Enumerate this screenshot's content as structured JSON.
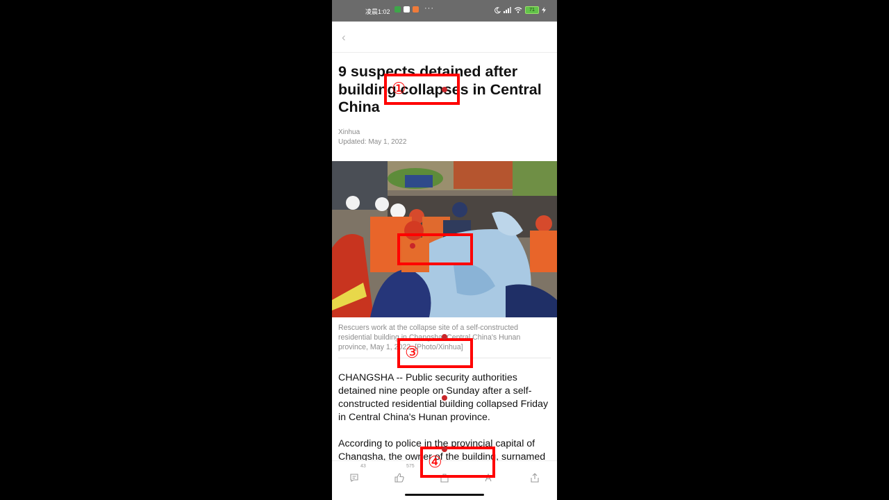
{
  "status_bar": {
    "time": "凌晨1:02",
    "dots": "···",
    "battery": "71",
    "icons": [
      "moon-icon",
      "signal-icon",
      "wifi-icon",
      "battery-icon",
      "charging-icon"
    ],
    "app_icon_colors": [
      "#3ea64a",
      "#e94c3c",
      "#f07b3a"
    ]
  },
  "header": {
    "back_icon": "chevron-left-icon",
    "back_glyph": "‹"
  },
  "article": {
    "headline": "9 suspects detained after building collapses in Central China",
    "source": "Xinhua",
    "updated": "Updated: May 1, 2022",
    "photo_desc": "rescue-scene-photo",
    "caption": "Rescuers work at the collapse site of a self-constructed residential building in Changsha, Central China's Hunan province, May 1, 2022. [Photo/Xinhua]",
    "paragraphs": [
      "CHANGSHA -- Public security authorities detained nine people on Sunday after a self-constructed residential building collapsed Friday in Central China's Hunan province.",
      "According to police in the provincial capital of Changsha, the owner of the building, surnamed"
    ]
  },
  "action_bar": {
    "comment_count": "43",
    "like_count": "575",
    "icons": [
      "comment-icon",
      "like-icon",
      "favorite-icon",
      "font-size-icon",
      "share-icon"
    ]
  },
  "annotations": {
    "color": "#ff0000",
    "labels": [
      "①",
      "③",
      "④"
    ]
  }
}
